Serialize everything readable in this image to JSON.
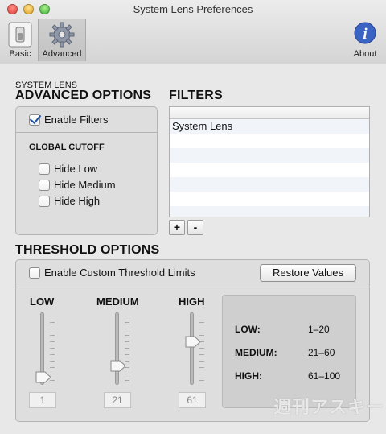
{
  "window": {
    "title": "System Lens Preferences"
  },
  "toolbar": {
    "basic_label": "Basic",
    "advanced_label": "Advanced",
    "about_label": "About",
    "about_glyph": "i"
  },
  "caption": "SYSTEM LENS",
  "advanced": {
    "title": "ADVANCED OPTIONS",
    "enable_filters": "Enable Filters",
    "global_cutoff": "GLOBAL CUTOFF",
    "hide_low": "Hide Low",
    "hide_medium": "Hide Medium",
    "hide_high": "Hide High"
  },
  "filters": {
    "title": "FILTERS",
    "rows": [
      "System Lens",
      "",
      "",
      "",
      "",
      "",
      ""
    ],
    "add_label": "+",
    "remove_label": "-"
  },
  "threshold": {
    "title": "THRESHOLD OPTIONS",
    "enable_custom": "Enable Custom Threshold Limits",
    "restore_label": "Restore Values",
    "low_label": "LOW",
    "medium_label": "MEDIUM",
    "high_label": "HIGH",
    "low_value": "1",
    "medium_value": "21",
    "high_value": "61",
    "summary": [
      {
        "label": "LOW:",
        "range": "1–20"
      },
      {
        "label": "MEDIUM:",
        "range": "21–60"
      },
      {
        "label": "HIGH:",
        "range": "61–100"
      }
    ]
  },
  "watermark": "週刊アスキー"
}
